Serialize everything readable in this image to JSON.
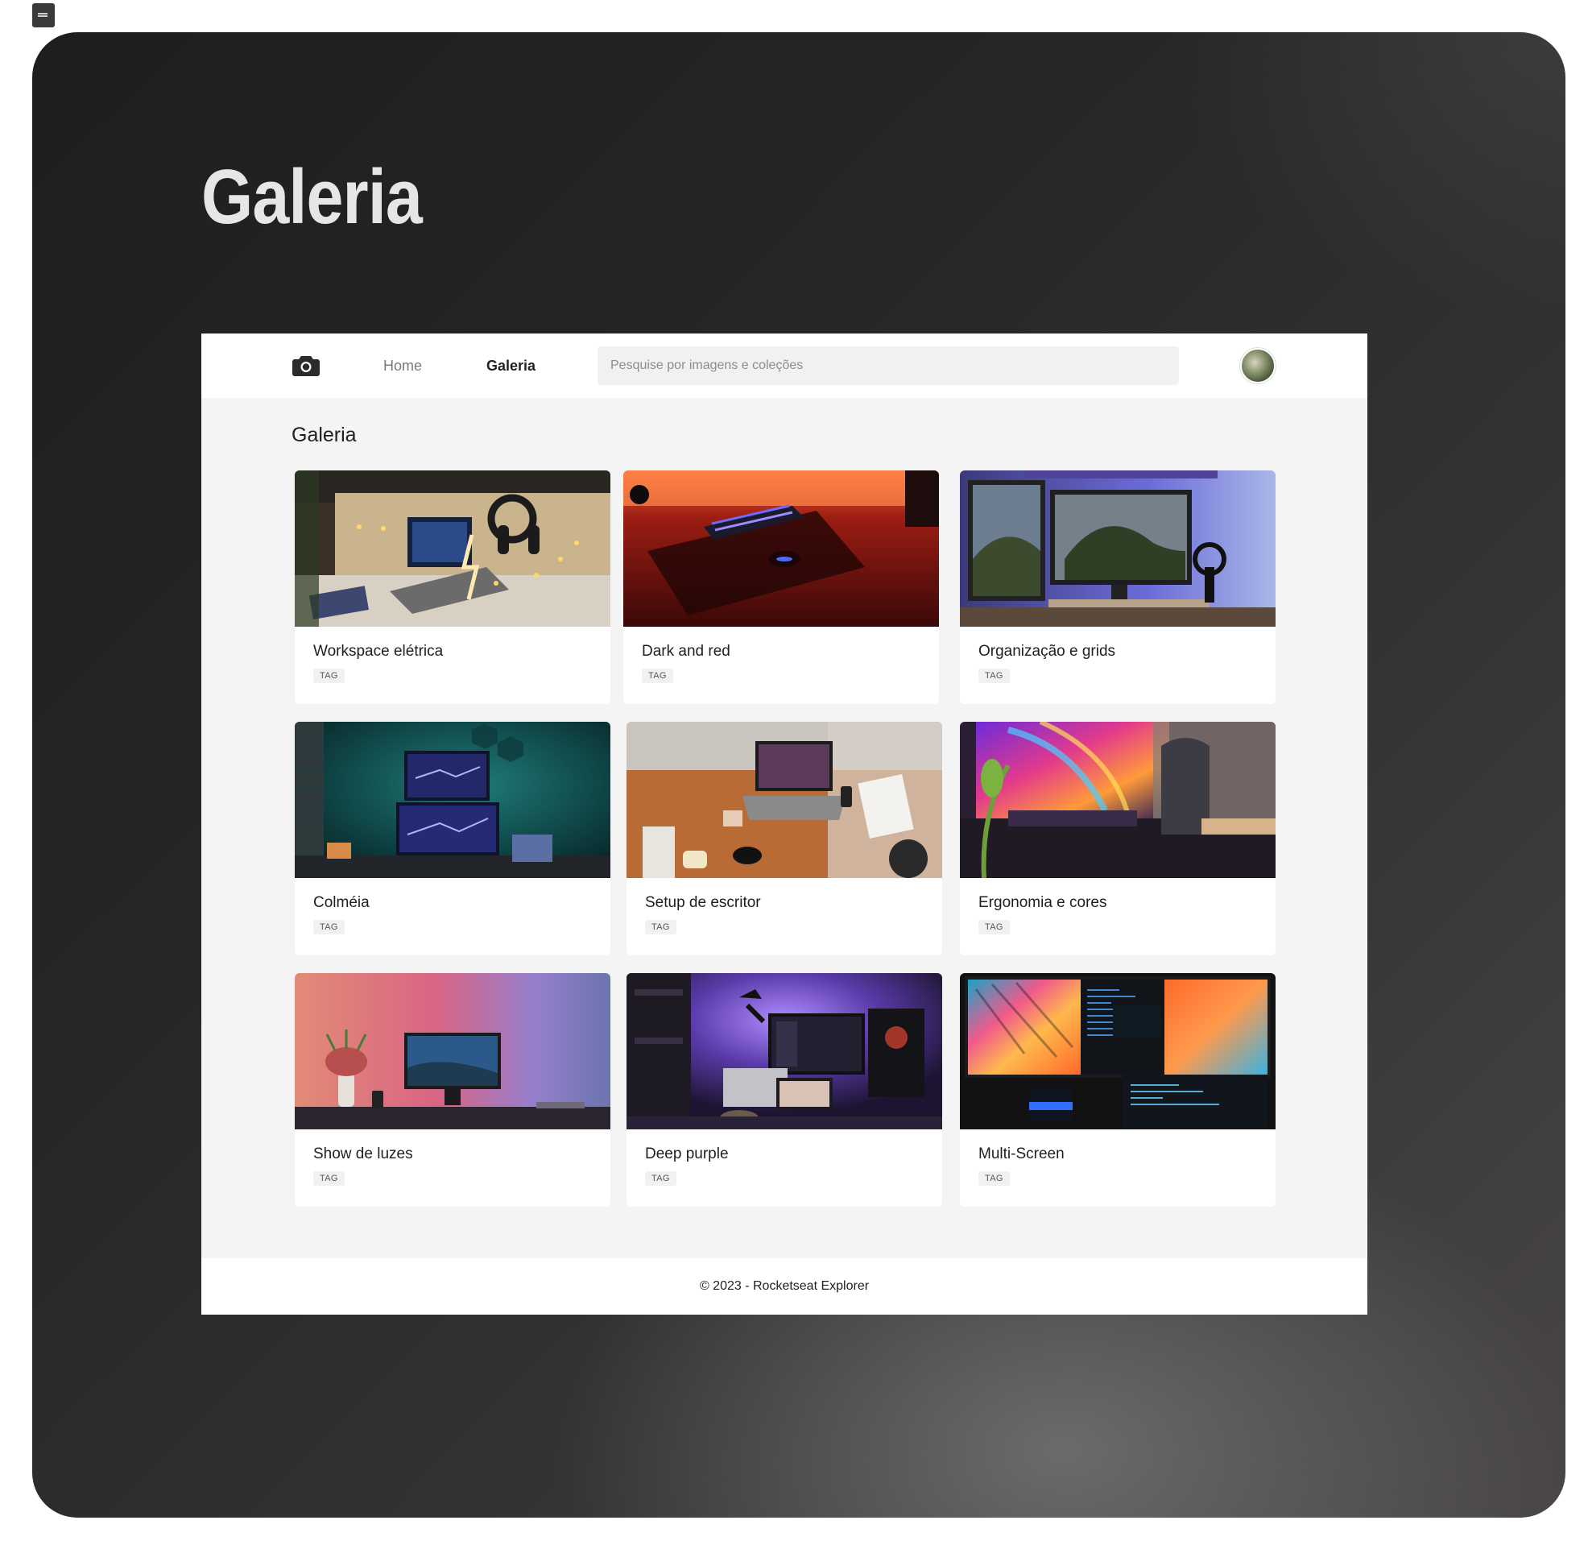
{
  "hero": {
    "title": "Galeria"
  },
  "header": {
    "nav": {
      "home": "Home",
      "galeria": "Galeria"
    },
    "search": {
      "placeholder": "Pesquise por imagens e coleções",
      "value": ""
    },
    "logo_icon": "camera-icon"
  },
  "main": {
    "title": "Galeria",
    "cards": [
      {
        "title": "Workspace elétrica",
        "tag": "TAG"
      },
      {
        "title": "Dark and red",
        "tag": "TAG"
      },
      {
        "title": "Organização e grids",
        "tag": "TAG"
      },
      {
        "title": "Colméia",
        "tag": "TAG"
      },
      {
        "title": "Setup de escritor",
        "tag": "TAG"
      },
      {
        "title": "Ergonomia e cores",
        "tag": "TAG"
      },
      {
        "title": "Show de luzes",
        "tag": "TAG"
      },
      {
        "title": "Deep purple",
        "tag": "TAG"
      },
      {
        "title": "Multi-Screen",
        "tag": "TAG"
      }
    ]
  },
  "footer": {
    "text": "© 2023 - Rocketseat Explorer"
  }
}
